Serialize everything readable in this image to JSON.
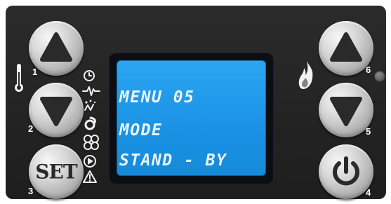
{
  "lcd": {
    "lines": [
      "MENU 05",
      "MODE",
      "STAND - BY"
    ]
  },
  "buttons": {
    "b1": {
      "number": "1",
      "icon": "triangle-up-icon"
    },
    "b2": {
      "number": "2",
      "icon": "triangle-down-icon"
    },
    "b3": {
      "number": "3",
      "label": "SET"
    },
    "b4": {
      "number": "4",
      "icon": "power-icon"
    },
    "b5": {
      "number": "5",
      "icon": "triangle-down-icon"
    },
    "b6": {
      "number": "6",
      "icon": "triangle-up-icon"
    }
  },
  "indicators": {
    "left_icons": [
      "thermometer-icon"
    ],
    "status_icons": [
      "clock-icon",
      "heartbeat-icon",
      "spark-icon",
      "fan-icon",
      "pump-icon",
      "flow-icon",
      "warning-icon"
    ],
    "right_icons": [
      "flame-icon",
      "led-indicator"
    ]
  },
  "colors": {
    "panel": "#252525",
    "lcd": "#1c93e6",
    "lcd_text": "#e9f7ff",
    "button": "#d6d6d6",
    "glyph": "#2a2a2a"
  }
}
